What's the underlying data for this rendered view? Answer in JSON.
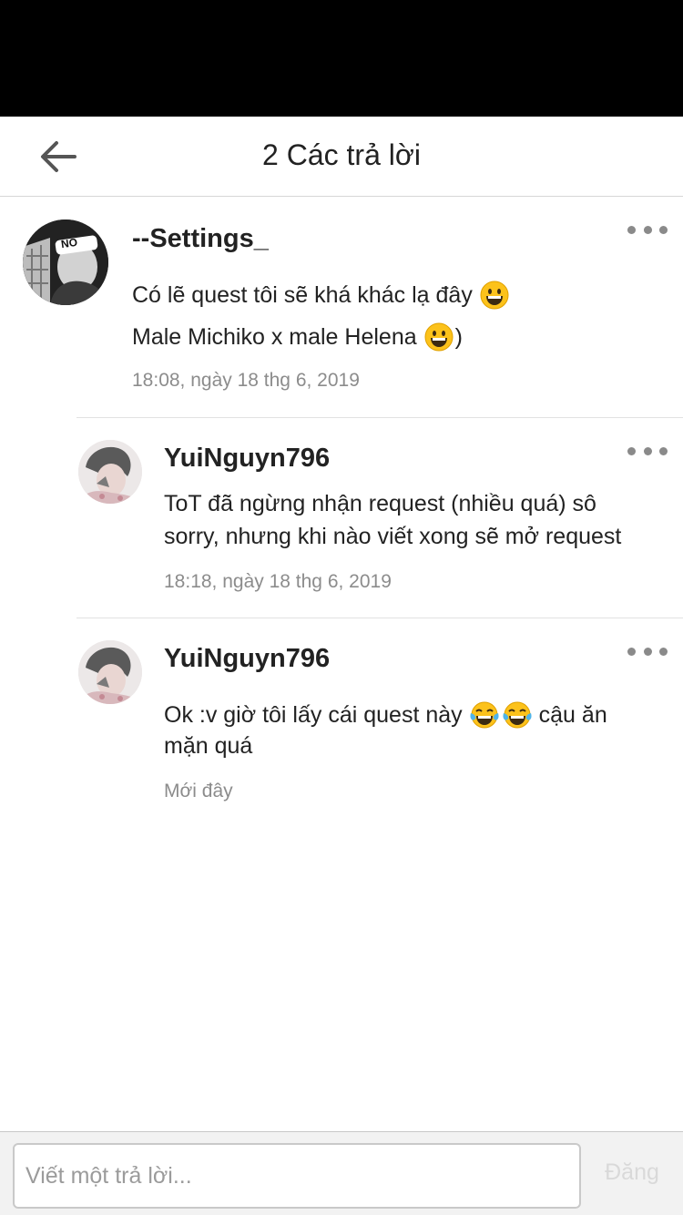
{
  "header": {
    "title": "2 Các trả lời"
  },
  "comments": [
    {
      "username": "--Settings_",
      "avatar_text": "NO",
      "lines": [
        {
          "text": "Có lẽ quest tôi sẽ khá khác lạ đây",
          "emojis": [
            "grinning-face"
          ]
        },
        {
          "text": "Male Michiko x male Helena",
          "emojis": [
            "grinning-face"
          ],
          "suffix": ")"
        }
      ],
      "timestamp": "18:08, ngày 18 thg 6, 2019"
    },
    {
      "username": "YuiNguyn796",
      "lines": [
        {
          "text": "ToT đã ngừng nhận request (nhiều quá) sô"
        },
        {
          "text": "sorry, nhưng khi nào viết xong sẽ mở request"
        }
      ],
      "timestamp": "18:18, ngày 18 thg 6, 2019"
    },
    {
      "username": "YuiNguyn796",
      "lines": [
        {
          "text": "Ok :v giờ tôi lấy cái quest này",
          "emojis": [
            "tears-of-joy-face",
            "tears-of-joy-face"
          ],
          "suffix": "cậu ăn"
        },
        {
          "text": "mặn quá"
        }
      ],
      "timestamp": "Mới đây"
    }
  ],
  "reply": {
    "placeholder": "Viết một trả lời...",
    "post_label": "Đăng"
  },
  "colors": {
    "status_bar": "#000000",
    "timestamp": "#8c8c8c",
    "post_disabled": "#d9d9d9"
  }
}
